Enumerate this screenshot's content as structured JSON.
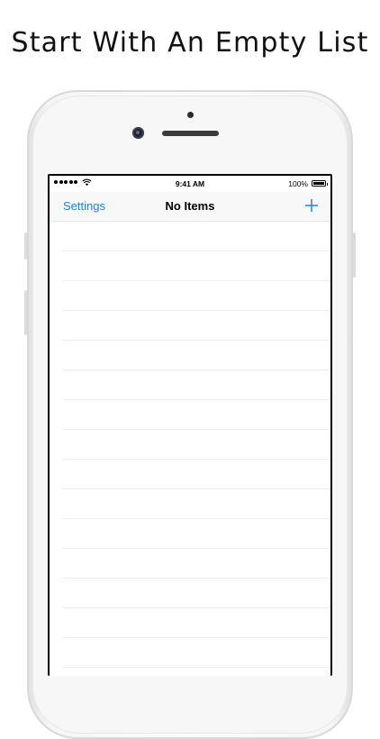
{
  "headline": "Start With An Empty List",
  "status_bar": {
    "time": "9:41 AM",
    "battery_percent": "100%",
    "signal_icon": "signal-dots-icon",
    "wifi_icon": "wifi-icon",
    "battery_icon": "battery-icon"
  },
  "nav_bar": {
    "left_label": "Settings",
    "title": "No Items",
    "right_icon": "plus-icon",
    "accent_color": "#1a83ea"
  },
  "list": {
    "item_count": 0
  }
}
